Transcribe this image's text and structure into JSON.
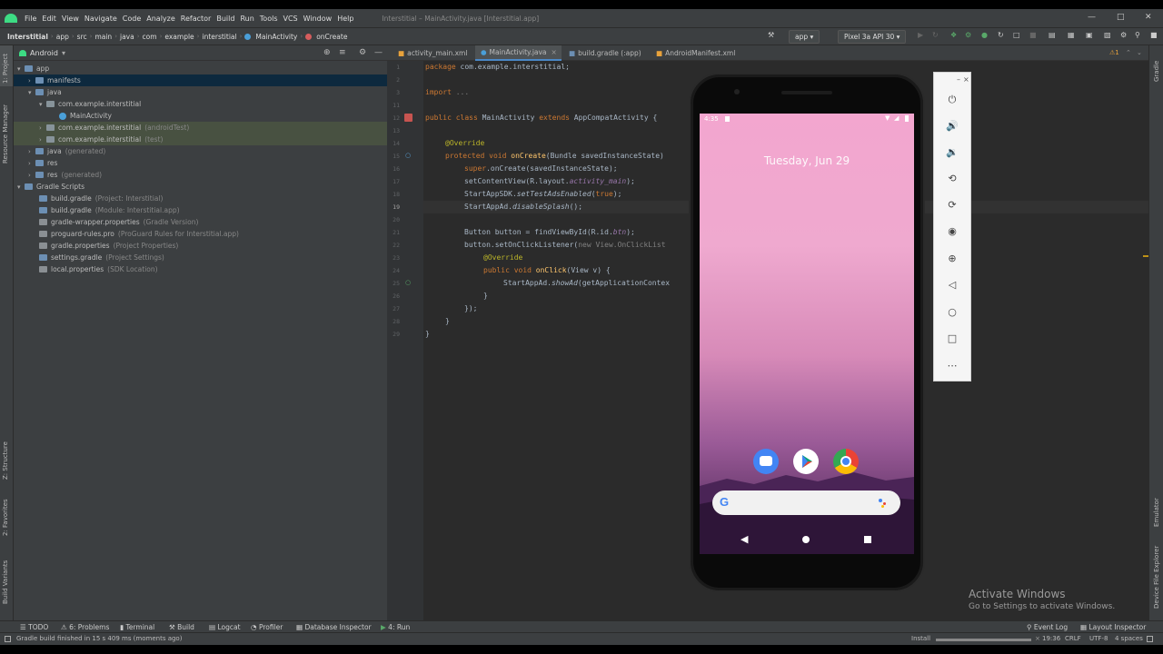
{
  "menu": [
    "File",
    "Edit",
    "View",
    "Navigate",
    "Code",
    "Analyze",
    "Refactor",
    "Build",
    "Run",
    "Tools",
    "VCS",
    "Window",
    "Help"
  ],
  "window_title": "Interstitial – MainActivity.java [Interstitial.app]",
  "breadcrumb": [
    "Interstitial",
    "app",
    "src",
    "main",
    "java",
    "com",
    "example",
    "interstitial",
    "MainActivity",
    "onCreate"
  ],
  "toolbar": {
    "run_config": "app",
    "device": "Pixel 3a API 30"
  },
  "project_panel": {
    "view_label": "Android",
    "tree": [
      {
        "label": "app",
        "suffix": ""
      },
      {
        "label": "manifests",
        "suffix": ""
      },
      {
        "label": "java",
        "suffix": ""
      },
      {
        "label": "com.example.interstitial",
        "suffix": ""
      },
      {
        "label": "MainActivity",
        "suffix": ""
      },
      {
        "label": "com.example.interstitial",
        "suffix": "(androidTest)"
      },
      {
        "label": "com.example.interstitial",
        "suffix": "(test)"
      },
      {
        "label": "java",
        "suffix": "(generated)"
      },
      {
        "label": "res",
        "suffix": ""
      },
      {
        "label": "res",
        "suffix": "(generated)"
      },
      {
        "label": "Gradle Scripts",
        "suffix": ""
      },
      {
        "label": "build.gradle",
        "suffix": "(Project: Interstitial)"
      },
      {
        "label": "build.gradle",
        "suffix": "(Module: Interstitial.app)"
      },
      {
        "label": "gradle-wrapper.properties",
        "suffix": "(Gradle Version)"
      },
      {
        "label": "proguard-rules.pro",
        "suffix": "(ProGuard Rules for Interstitial.app)"
      },
      {
        "label": "gradle.properties",
        "suffix": "(Project Properties)"
      },
      {
        "label": "settings.gradle",
        "suffix": "(Project Settings)"
      },
      {
        "label": "local.properties",
        "suffix": "(SDK Location)"
      }
    ]
  },
  "left_tool_windows": [
    "1: Project",
    "Resource Manager",
    "Z: Structure",
    "2: Favorites",
    "Build Variants"
  ],
  "right_tool_windows": [
    "Gradle",
    "Emulator",
    "Device File Explorer"
  ],
  "editor_tabs": [
    "activity_main.xml",
    "MainActivity.java",
    "build.gradle (:app)",
    "AndroidManifest.xml"
  ],
  "line_numbers": [
    "1",
    "2",
    "3",
    "11",
    "12",
    "13",
    "14",
    "15",
    "16",
    "17",
    "18",
    "19",
    "20",
    "21",
    "22",
    "23",
    "24",
    "25",
    "26",
    "27",
    "28",
    "29"
  ],
  "code": {
    "l1_kw": "package",
    "l1_rest": " com.example.interstitial;",
    "l3_kw": "import",
    "l3_rest": " ...",
    "l12_kw": "public class",
    "l12_name": " MainActivity ",
    "l12_kw2": "extends",
    "l12_rest": " AppCompatActivity {",
    "l14": "@Override",
    "l15_kw": "protected void",
    "l15_fn": " onCreate",
    "l15_rest": "(Bundle savedInstanceState)",
    "l16_kw": "super",
    "l16_rest": ".onCreate(savedInstanceState);",
    "l17_a": "setContentView(R.layout.",
    "l17_b": "activity_main",
    "l17_c": ");",
    "l18_a": "StartAppSDK.",
    "l18_b": "setTestAdsEnabled",
    "l18_c": "(",
    "l18_d": "true",
    "l18_e": ");",
    "l19_a": "StartAppAd.",
    "l19_b": "disableSplash",
    "l19_c": "();",
    "l21_a": "Button button = findViewById(R.id.",
    "l21_b": "btn",
    "l21_c": ");",
    "l22_a": "button.setOnClickListener(",
    "l22_b": "new View.OnClickList",
    "l23": "@Override",
    "l24_kw": "public void",
    "l24_fn": " onClick",
    "l24_rest": "(View v) {",
    "l25_a": "StartAppAd.",
    "l25_b": "showAd",
    "l25_c": "(getApplicationContex",
    "l26": "}",
    "l27": "});",
    "l28": "}",
    "l29": "}"
  },
  "phone": {
    "time": "4:35",
    "date": "Tuesday, Jun 29"
  },
  "bottom_tools": [
    "TODO",
    "6: Problems",
    "Terminal",
    "Build",
    "Logcat",
    "Profiler",
    "Database Inspector",
    "4: Run",
    "Event Log",
    "Layout Inspector"
  ],
  "status": {
    "message": "Gradle build finished in 15 s 409 ms (moments ago)",
    "install": "Install",
    "position": "19:36",
    "line_sep": "CRLF",
    "encoding": "UTF-8",
    "indent": "4 spaces"
  },
  "activate_windows": {
    "title": "Activate Windows",
    "subtitle": "Go to Settings to activate Windows."
  },
  "colors": {
    "ide_bg": "#2b2b2b",
    "panel_bg": "#3c3f41",
    "selection": "#0d293e",
    "keyword": "#cc7832",
    "annotation": "#bbb529",
    "function": "#ffc66d"
  }
}
